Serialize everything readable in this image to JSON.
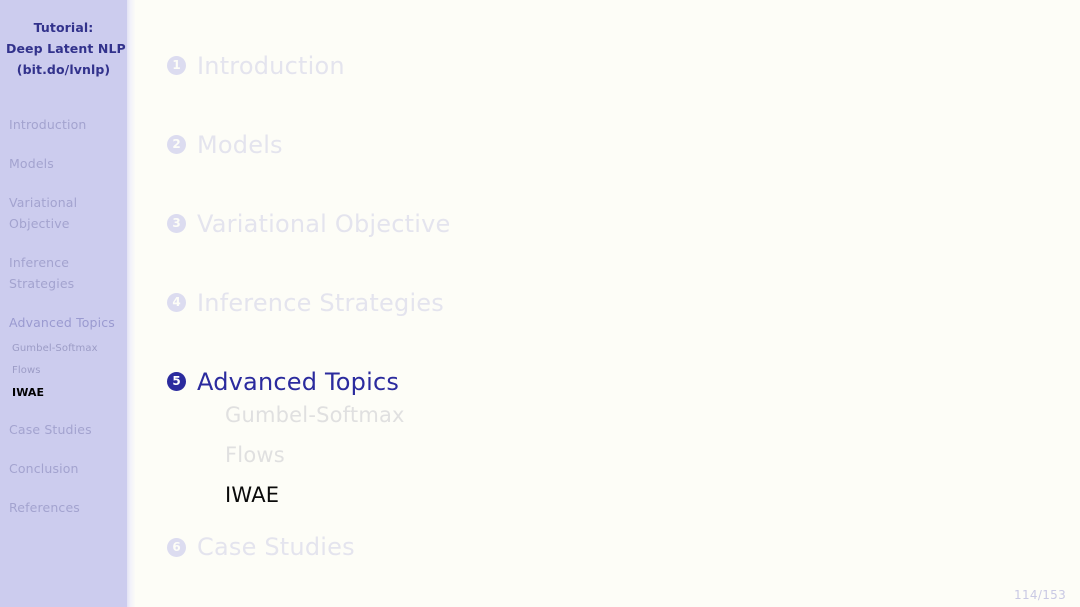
{
  "sidebar": {
    "title_lines": [
      "Tutorial:",
      "Deep Latent NLP",
      "(bit.do/lvnlp)"
    ],
    "items": [
      {
        "label": "Introduction"
      },
      {
        "label": "Models"
      },
      {
        "label_line1": "Variational",
        "label_line2": "Objective"
      },
      {
        "label_line1": "Inference",
        "label_line2": "Strategies"
      },
      {
        "label": "Advanced Topics"
      },
      {
        "label": "Case Studies"
      },
      {
        "label": "Conclusion"
      },
      {
        "label": "References"
      }
    ],
    "subitems": [
      {
        "label": "Gumbel-Softmax"
      },
      {
        "label": "Flows"
      },
      {
        "label": "IWAE"
      }
    ]
  },
  "toc": {
    "entries": [
      {
        "number": "1",
        "label": "Introduction"
      },
      {
        "number": "2",
        "label": "Models"
      },
      {
        "number": "3",
        "label": "Variational Objective"
      },
      {
        "number": "4",
        "label": "Inference Strategies"
      },
      {
        "number": "5",
        "label": "Advanced Topics"
      },
      {
        "number": "6",
        "label": "Case Studies"
      }
    ],
    "subentries": [
      {
        "label": "Gumbel-Softmax"
      },
      {
        "label": "Flows"
      },
      {
        "label": "IWAE"
      }
    ]
  },
  "footer": {
    "page_number": "114/153"
  },
  "colors": {
    "sidebar_background": "#ccccee",
    "slide_background": "#fdfdf7",
    "accent": "#2b2b9e",
    "title": "#32328c",
    "muted": "#e4e4ee",
    "current_text": "#0a0a0a"
  }
}
